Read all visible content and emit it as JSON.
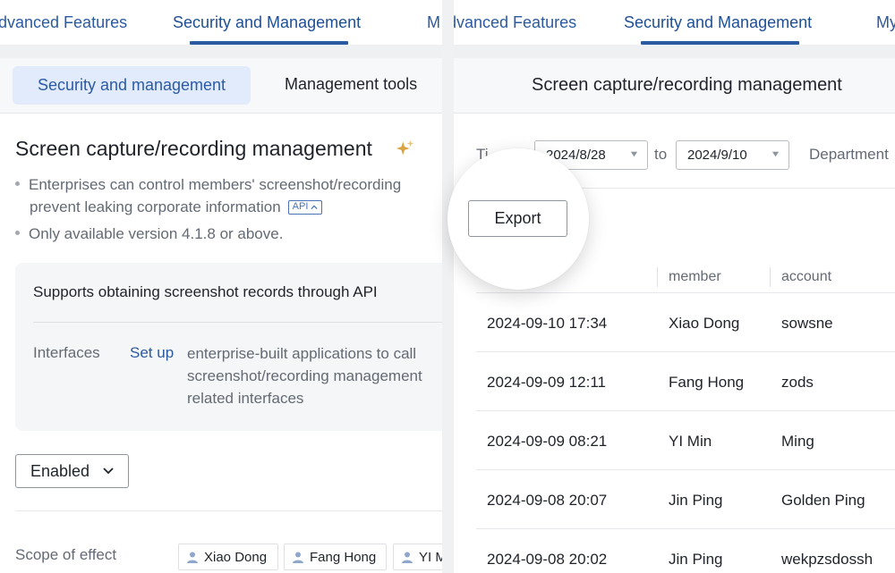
{
  "left": {
    "nav": {
      "tab_prev": "dvanced Features",
      "tab_active": "Security and Management",
      "tab_next": "M"
    },
    "subtabs": {
      "active": "Security and management",
      "other": "Management tools"
    },
    "section": {
      "title": "Screen capture/recording management",
      "bullet_1_line_1": "Enterprises can control members' screenshot/recording",
      "bullet_1_line_2": "prevent leaking corporate information",
      "api_badge": "API",
      "bullet_2": "Only available version 4.1.8 or above."
    },
    "api_card": {
      "title": "Supports obtaining screenshot records through API",
      "interfaces_label": "Interfaces",
      "setup_link": "Set up",
      "description": "enterprise-built applications to call screenshot/recording management related interfaces"
    },
    "status_select": {
      "value": "Enabled"
    },
    "scope": {
      "label": "Scope of effect",
      "members": [
        "Xiao Dong",
        "Fang Hong",
        "YI M"
      ]
    }
  },
  "right": {
    "nav": {
      "tab_prev": "dvanced Features",
      "tab_active": "Security and Management",
      "tab_next": "My"
    },
    "header_title": "Screen capture/recording management",
    "filters": {
      "time_label": "Ti",
      "start_date": "2024/8/28",
      "to_label": "to",
      "end_date": "2024/9/10",
      "department_label": "Department"
    },
    "export_label": "Export",
    "table": {
      "columns": [
        "member",
        "account"
      ],
      "rows": [
        {
          "time": "2024-09-10 17:34",
          "member": "Xiao Dong",
          "account": "sowsne"
        },
        {
          "time": "2024-09-09 12:11",
          "member": "Fang Hong",
          "account": "zods"
        },
        {
          "time": "2024-09-09 08:21",
          "member": "YI Min",
          "account": "Ming"
        },
        {
          "time": "2024-09-08 20:07",
          "member": "Jin Ping",
          "account": "Golden Ping"
        },
        {
          "time": "2024-09-08 20:02",
          "member": "Jin Ping",
          "account": "wekpzsdossh"
        }
      ]
    }
  },
  "colors": {
    "accent": "#2b5aa0",
    "active_tab_bg": "#e1ebfb",
    "sparkle": "#d9a441"
  }
}
